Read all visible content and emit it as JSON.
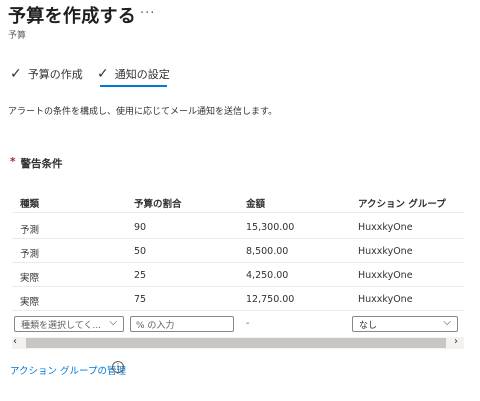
{
  "header": {
    "title": "予算を作成する",
    "more": "···",
    "subtitle": "予算"
  },
  "steps": [
    {
      "label": "予算の作成",
      "completed": true
    },
    {
      "label": "通知の設定",
      "completed": true,
      "active": true
    }
  ],
  "description": "アラートの条件を構成し、使用に応じてメール通知を送信します。",
  "section": {
    "required_mark": "*",
    "title": "警告条件"
  },
  "table": {
    "columns": [
      "種類",
      "予算の割合",
      "金額",
      "アクション グループ"
    ],
    "rows": [
      [
        "予測",
        "90",
        "15,300.00",
        "HuxxkyOne"
      ],
      [
        "予測",
        "50",
        "8,500.00",
        "HuxxkyOne"
      ],
      [
        "実際",
        "25",
        "4,250.00",
        "HuxxkyOne"
      ],
      [
        "実際",
        "75",
        "12,750.00",
        "HuxxkyOne"
      ]
    ],
    "new_row": {
      "type_placeholder": "種類を選択してく...",
      "percent_placeholder": "% の入力",
      "amount": "-",
      "action_group_value": "なし"
    }
  },
  "scrollbar": {
    "left_arrow": "‹",
    "right_arrow": "›"
  },
  "link": {
    "label": "アクション グループの管理",
    "info_icon": "i"
  },
  "colors": {
    "accent": "#0078d4",
    "required": "#a4262c"
  }
}
